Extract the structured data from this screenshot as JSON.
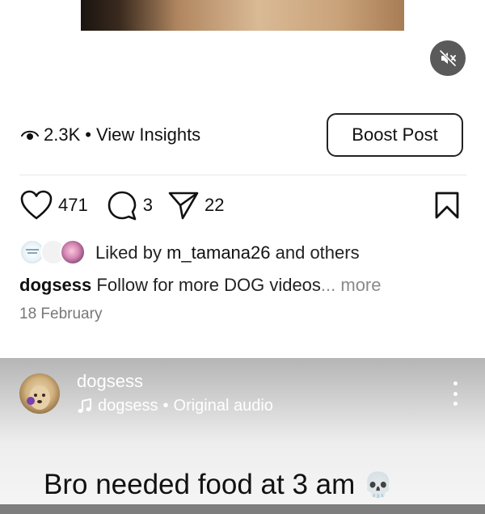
{
  "post": {
    "views": "2.3K",
    "separator": "•",
    "insights_label": "View Insights",
    "boost_label": "Boost Post",
    "likes": "471",
    "comments": "3",
    "shares": "22",
    "liked_by_prefix": "Liked by",
    "liked_by_user": "m_tamana26",
    "liked_by_suffix": "and others",
    "caption_user": "dogsess",
    "caption_text": "Follow for more DOG videos",
    "caption_more": "... more",
    "date": "18 February"
  },
  "next_post": {
    "username": "dogsess",
    "audio_user": "dogsess",
    "audio_separator": "•",
    "audio_label": "Original audio",
    "overlay_text": "Bro needed food at 3 am",
    "overlay_emoji": "💀"
  },
  "icons": {
    "mute": "mute-icon",
    "eye": "eye-icon",
    "heart": "heart-icon",
    "comment": "comment-icon",
    "share": "share-icon",
    "bookmark": "bookmark-icon",
    "music": "music-note-icon",
    "more": "more-vertical-icon"
  }
}
